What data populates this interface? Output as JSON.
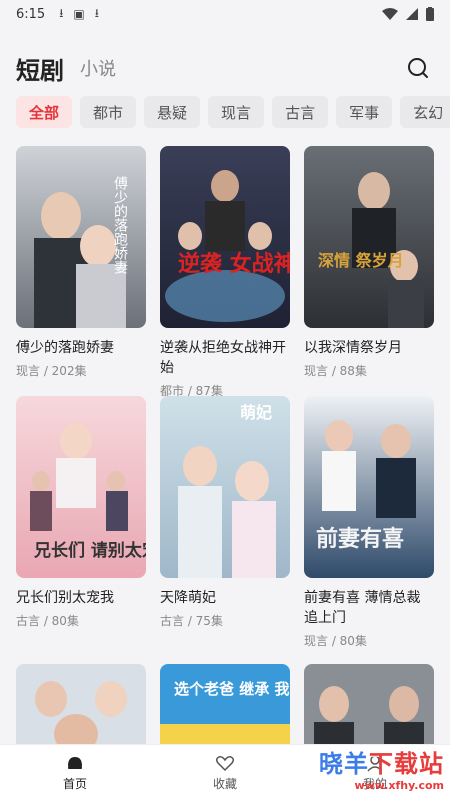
{
  "status": {
    "time": "6:15"
  },
  "header": {
    "tab_active": "短剧",
    "tab_inactive": "小说"
  },
  "categories": [
    "全部",
    "都市",
    "悬疑",
    "现言",
    "古言",
    "军事",
    "玄幻"
  ],
  "dramas": [
    {
      "title": "傅少的落跑娇妻",
      "meta": "现言 / 202集",
      "poster_text": "傅少的落跑娇妻"
    },
    {
      "title": "逆袭从拒绝女战神开始",
      "meta": "都市 / 87集",
      "poster_text": "逆袭 女战神"
    },
    {
      "title": "以我深情祭岁月",
      "meta": "现言 / 88集",
      "poster_text": "深情 祭岁月"
    },
    {
      "title": "兄长们别太宠我",
      "meta": "古言 / 80集",
      "poster_text": "兄长们 请别太宠我"
    },
    {
      "title": "天降萌妃",
      "meta": "古言 / 75集",
      "poster_text": "萌妃"
    },
    {
      "title": "前妻有喜 薄情总裁追上门",
      "meta": "现言 / 80集",
      "poster_text": "前妻有喜"
    }
  ],
  "row3": [
    {
      "poster_text": ""
    },
    {
      "poster_text": "选个老爸 继承 我的"
    },
    {
      "poster_text": ""
    }
  ],
  "nav": {
    "home": "首页",
    "favorites": "收藏",
    "profile": "我的"
  },
  "watermark": {
    "main_a": "晓羊",
    "main_b": "下载站",
    "url": "www.xfhy.com"
  },
  "colors": {
    "accent": "#e6333a",
    "chip_active_bg": "#fde4e4"
  }
}
